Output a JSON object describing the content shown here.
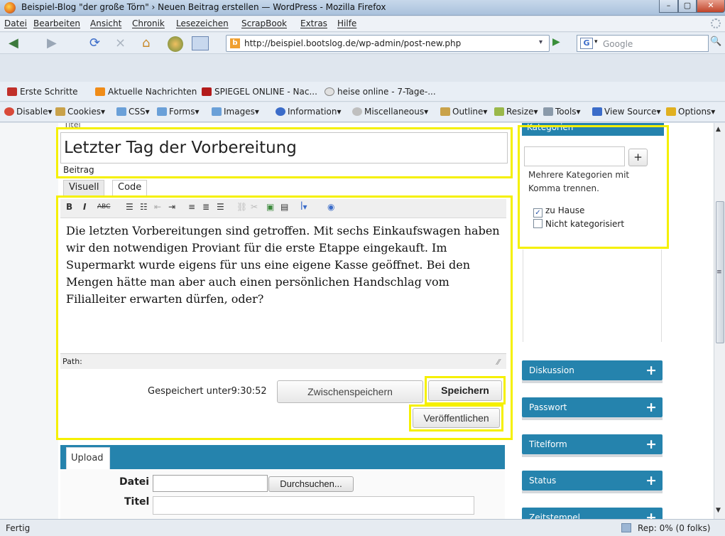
{
  "window": {
    "title": "Beispiel-Blog \"der große Törn\" › Neuen Beitrag erstellen — WordPress - Mozilla Firefox",
    "min_icon": "minimize-icon",
    "max_icon": "maximize-icon",
    "close_icon": "close-icon",
    "min_glyph": "–",
    "max_glyph": "▢",
    "close_glyph": "✕"
  },
  "menu": [
    "Datei",
    "Bearbeiten",
    "Ansicht",
    "Chronik",
    "Lesezeichen",
    "ScrapBook",
    "Extras",
    "Hilfe"
  ],
  "nav": {
    "back_glyph": "◀",
    "forward_glyph": "▶",
    "reload_glyph": "⟳",
    "stop_glyph": "⨯",
    "home_glyph": "⌂",
    "url": "http://beispiel.bootslog.de/wp-admin/post-new.php",
    "favicon_letter": "b",
    "dropdown_glyph": "▾",
    "go_glyph": "▶",
    "search_engine": "G",
    "search_placeholder": "Google",
    "search_glyph": "🔍"
  },
  "bookmarks": [
    {
      "label": "Erste Schritte",
      "color": "#c0302a"
    },
    {
      "label": "Aktuelle Nachrichten",
      "color": "#f08c18"
    },
    {
      "label": "SPIEGEL ONLINE - Nac...",
      "color": "#b31b1b"
    },
    {
      "label": "heise online - 7-Tage-...",
      "color": "#e0e0e0"
    }
  ],
  "devtools": [
    {
      "label": "Disable▾",
      "color": "#d84a3a"
    },
    {
      "label": "Cookies▾",
      "color": "#c9a24a"
    },
    {
      "label": "CSS▾",
      "color": "#6aa0d8"
    },
    {
      "label": "Forms▾",
      "color": "#6aa0d8"
    },
    {
      "label": "Images▾",
      "color": "#6aa0d8"
    },
    {
      "label": "Information▾",
      "color": "#3b6cc9"
    },
    {
      "label": "Miscellaneous▾",
      "color": "#bfbfbf"
    },
    {
      "label": "Outline▾",
      "color": "#c9a24a"
    },
    {
      "label": "Resize▾",
      "color": "#9ab84a"
    },
    {
      "label": "Tools▾",
      "color": "#8a9aaa"
    },
    {
      "label": "View Source▾",
      "color": "#3b6cc9"
    },
    {
      "label": "Options▾",
      "color": "#e0b020"
    }
  ],
  "post": {
    "title_label_cut": "Titel",
    "title": "Letzter Tag der Vorbereitung",
    "sub_label": "Beitrag",
    "tab_visual": "Visuell",
    "tab_code": "Code",
    "toolbar": [
      "B",
      "I",
      "ABC",
      "☰",
      "☷",
      "⇤",
      "⇥",
      "≡",
      "≣",
      "☰",
      "⛓",
      "✂",
      "▣",
      "▤",
      "ꟾ▾",
      "◉"
    ],
    "body": "Die letzten Vorbereitungen sind getroffen. Mit sechs Einkaufswagen haben wir den notwendigen Proviant für die erste Etappe eingekauft. Im Supermarkt wurde eigens für uns eine eigene Kasse geöffnet. Bei den Mengen hätte man aber auch einen persönlichen Handschlag vom Filialleiter erwarten dürfen, oder?",
    "path_label": "Path:",
    "resize_glyph": "⁄⁄",
    "saved_text": "Gespeichert unter9:30:52",
    "draft_button": "Zwischenspeichern",
    "save_button": "Speichern",
    "publish_button": "Veröffentlichen"
  },
  "upload": {
    "tab": "Upload",
    "file_label": "Datei",
    "browse_button": "Durchsuchen...",
    "title_label": "Titel"
  },
  "sidebar": {
    "categories": {
      "header": "Kategorien",
      "add_glyph": "+",
      "note": "Mehrere Kategorien mit Komma trennen.",
      "items": [
        {
          "label": "zu Hause",
          "checked": true,
          "mark": "✓"
        },
        {
          "label": "Nicht kategorisiert",
          "checked": false,
          "mark": ""
        }
      ]
    },
    "boxes": [
      "Diskussion",
      "Passwort",
      "Titelform",
      "Status",
      "Zeitstempel"
    ],
    "plus_glyph": "+"
  },
  "scroll": {
    "up_glyph": "▲",
    "down_glyph": "▼",
    "grip_glyph": "≡"
  },
  "status": {
    "text": "Fertig",
    "rep": "Rep: 0% (0 folks)"
  },
  "colors": {
    "accent": "#2583ad",
    "highlight": "#f5f000"
  }
}
